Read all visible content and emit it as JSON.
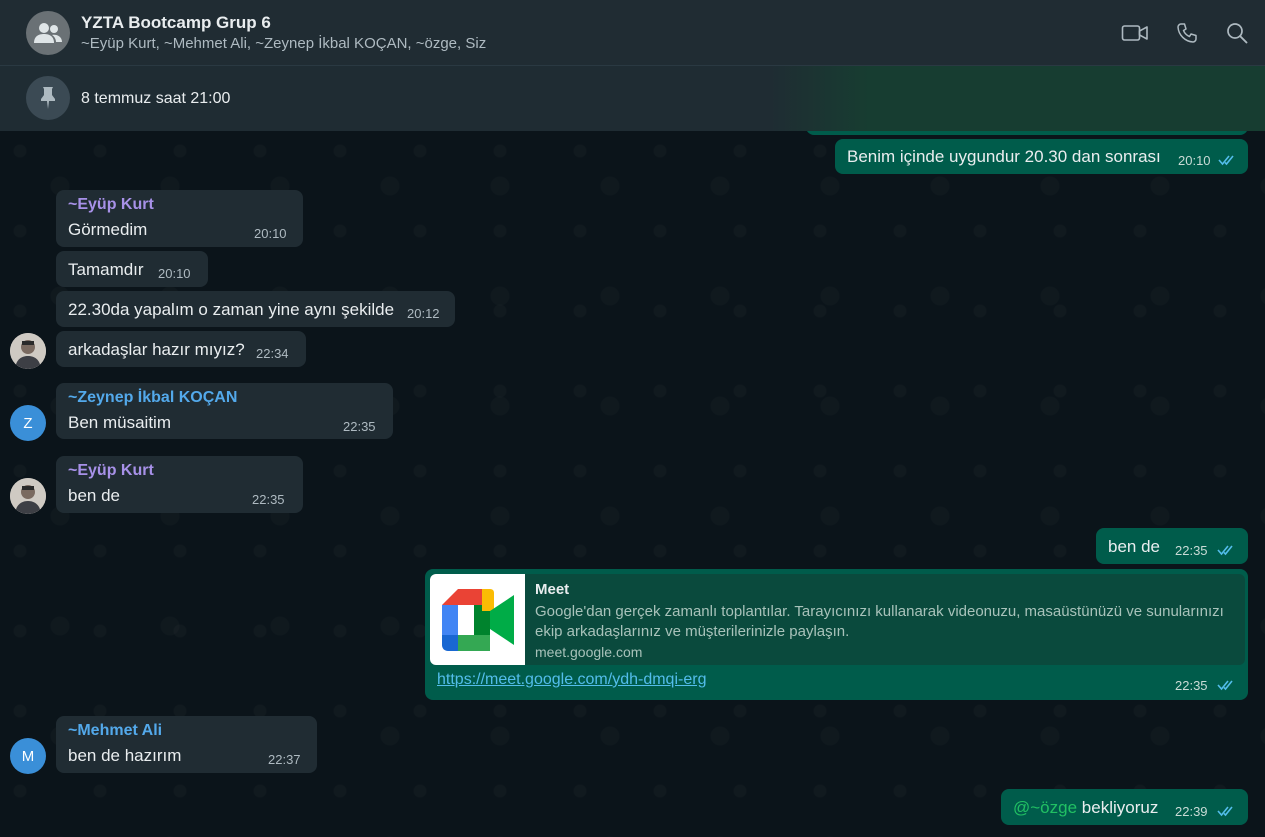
{
  "header": {
    "title": "YZTA Bootcamp Grup 6",
    "members": "~Eyüp Kurt, ~Mehmet Ali, ~Zeynep İkbal KOÇAN, ~özge, Siz",
    "icons": [
      "video-call-icon",
      "voice-call-icon",
      "search-icon"
    ]
  },
  "pinned": {
    "text": "8 temmuz saat 21:00",
    "icon": "pin-icon"
  },
  "messages": {
    "m1": {
      "text": "Benim içinde uygundur 20.30 dan sonrası",
      "time": "20:10"
    },
    "m2": {
      "sender": "~Eyüp Kurt",
      "text": "Görmedim",
      "time": "20:10"
    },
    "m3": {
      "text": "Tamamdır",
      "time": "20:10"
    },
    "m4": {
      "text": "22.30da yapalım o zaman yine aynı şekilde",
      "time": "20:12"
    },
    "m5": {
      "text": "arkadaşlar hazır mıyız?",
      "time": "22:34"
    },
    "m6": {
      "sender": "~Zeynep İkbal KOÇAN",
      "avatar_letter": "Z",
      "text": "Ben müsaitim",
      "time": "22:35"
    },
    "m7": {
      "sender": "~Eyüp Kurt",
      "text": "ben de",
      "time": "22:35"
    },
    "m8": {
      "text": "ben de",
      "time": "22:35"
    },
    "m9": {
      "card_title": "Meet",
      "card_desc": "Google'dan gerçek zamanlı toplantılar. Tarayıcınızı kullanarak videonuzu, masaüstünüzü ve sunularınızı ekip arkadaşlarınız ve müşterilerinizle paylaşın.",
      "card_domain": "meet.google.com",
      "url": "https://meet.google.com/ydh-dmqi-erg",
      "time": "22:35"
    },
    "m10": {
      "sender": "~Mehmet Ali",
      "avatar_letter": "M",
      "text": "ben de hazırım",
      "time": "22:37"
    },
    "m11": {
      "mention": "@~özge",
      "text": " bekliyoruz",
      "time": "22:39"
    }
  },
  "colors": {
    "incoming_bubble": "#202c33",
    "outgoing_bubble": "#005c4b",
    "read_ticks": "#53bdeb",
    "sender_eyup": "#a791e8",
    "sender_zeynep": "#53a9eb",
    "sender_mehmet": "#53a9eb",
    "mention": "#21c063"
  }
}
